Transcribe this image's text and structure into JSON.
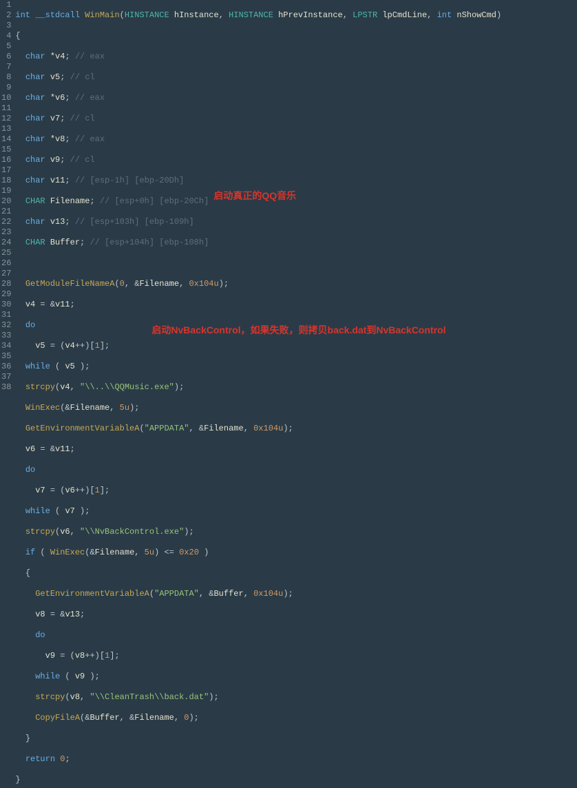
{
  "annotations": {
    "a1": "启动真正的QQ音乐",
    "a2": "启动NvBackControl，如果失败，则拷贝back.dat到NvBackControl"
  },
  "gutter": [
    "1",
    "2",
    "3",
    "4",
    "5",
    "6",
    "7",
    "8",
    "9",
    "10",
    "11",
    "12",
    "13",
    "14",
    "15",
    "16",
    "17",
    "18",
    "19",
    "20",
    "21",
    "22",
    "23",
    "24",
    "25",
    "26",
    "27",
    "28",
    "29",
    "30",
    "31",
    "32",
    "33",
    "34",
    "35",
    "36",
    "37",
    "38"
  ],
  "code": {
    "l1_kw_int": "int",
    "l1_kw_stdcall": "__stdcall",
    "l1_fn": "WinMain",
    "l1_t1": "HINSTANCE",
    "l1_p1": "hInstance",
    "l1_t2": "HINSTANCE",
    "l1_p2": "hPrevInstance",
    "l1_t3": "LPSTR",
    "l1_p3": "lpCmdLine",
    "l1_t4": "int",
    "l1_p4": "nShowCmd",
    "l2": "{",
    "l3_t": "char",
    "l3_v": "*v4",
    "l3_c": "// eax",
    "l4_t": "char",
    "l4_v": "v5",
    "l4_c": "// cl",
    "l5_t": "char",
    "l5_v": "*v6",
    "l5_c": "// eax",
    "l6_t": "char",
    "l6_v": "v7",
    "l6_c": "// cl",
    "l7_t": "char",
    "l7_v": "*v8",
    "l7_c": "// eax",
    "l8_t": "char",
    "l8_v": "v9",
    "l8_c": "// cl",
    "l9_t": "char",
    "l9_v": "v11",
    "l9_c": "// [esp-1h] [ebp-20Dh]",
    "l10_t": "CHAR",
    "l10_v": "Filename",
    "l10_c": "// [esp+0h] [ebp-20Ch]",
    "l11_t": "char",
    "l11_v": "v13",
    "l11_c": "// [esp+103h] [ebp-109h]",
    "l12_t": "CHAR",
    "l12_v": "Buffer",
    "l12_c": "// [esp+104h] [ebp-108h]",
    "l14_fn": "GetModuleFileNameA",
    "l14_n1": "0",
    "l14_v": "Filename",
    "l14_n2": "0x104u",
    "l15_l": "v4",
    "l15_r": "v11",
    "l16": "do",
    "l17_l": "v5",
    "l17_r": "v4",
    "l17_n": "1",
    "l18_kw": "while",
    "l18_v": "v5",
    "l19_fn": "strcpy",
    "l19_v": "v4",
    "l19_s": "\"\\\\..\\\\QQMusic.exe\"",
    "l20_fn": "WinExec",
    "l20_v": "Filename",
    "l20_n": "5u",
    "l21_fn": "GetEnvironmentVariableA",
    "l21_s": "\"APPDATA\"",
    "l21_v": "Filename",
    "l21_n": "0x104u",
    "l22_l": "v6",
    "l22_r": "v11",
    "l23": "do",
    "l24_l": "v7",
    "l24_r": "v6",
    "l24_n": "1",
    "l25_kw": "while",
    "l25_v": "v7",
    "l26_fn": "strcpy",
    "l26_v": "v6",
    "l26_s": "\"\\\\NvBackControl.exe\"",
    "l27_kw": "if",
    "l27_fn": "WinExec",
    "l27_v": "Filename",
    "l27_n1": "5u",
    "l27_n2": "0x20",
    "l28": "{",
    "l29_fn": "GetEnvironmentVariableA",
    "l29_s": "\"APPDATA\"",
    "l29_v": "Buffer",
    "l29_n": "0x104u",
    "l30_l": "v8",
    "l30_r": "v13",
    "l31": "do",
    "l32_l": "v9",
    "l32_r": "v8",
    "l32_n": "1",
    "l33_kw": "while",
    "l33_v": "v9",
    "l34_fn": "strcpy",
    "l34_v": "v8",
    "l34_s": "\"\\\\CleanTrash\\\\back.dat\"",
    "l35_fn": "CopyFileA",
    "l35_v1": "Buffer",
    "l35_v2": "Filename",
    "l35_n": "0",
    "l36": "}",
    "l37_kw": "return",
    "l37_n": "0",
    "l38": "}"
  }
}
